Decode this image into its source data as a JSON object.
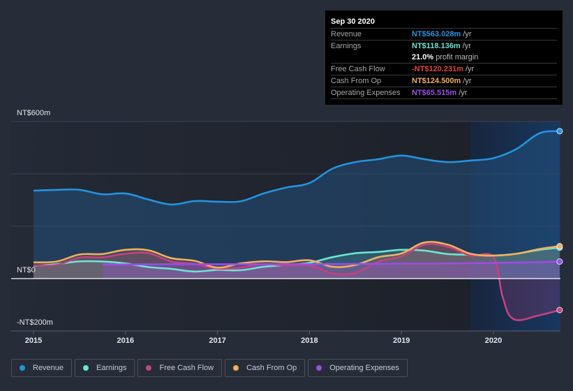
{
  "tooltip": {
    "date": "Sep 30 2020",
    "rows": [
      {
        "label": "Revenue",
        "value": "NT$563.028m",
        "unit": "/yr",
        "color": "#2394df"
      },
      {
        "label": "Earnings",
        "value": "NT$118.136m",
        "unit": "/yr",
        "color": "#6ce5d1"
      },
      {
        "label": "",
        "value": "21.0%",
        "unit": "profit margin",
        "color": "#ffffff"
      },
      {
        "label": "Free Cash Flow",
        "value": "-NT$120.231m",
        "unit": "/yr",
        "color": "#e64141"
      },
      {
        "label": "Cash From Op",
        "value": "NT$124.500m",
        "unit": "/yr",
        "color": "#f0b05c"
      },
      {
        "label": "Operating Expenses",
        "value": "NT$65.515m",
        "unit": "/yr",
        "color": "#9d4ce8"
      }
    ]
  },
  "legend": [
    {
      "label": "Revenue",
      "color": "#2394df"
    },
    {
      "label": "Earnings",
      "color": "#6ce5d1"
    },
    {
      "label": "Free Cash Flow",
      "color": "#c4427f"
    },
    {
      "label": "Cash From Op",
      "color": "#f0b05c"
    },
    {
      "label": "Operating Expenses",
      "color": "#9d4ce8"
    }
  ],
  "chart_data": {
    "type": "area",
    "title": "",
    "xlabel": "",
    "ylabel": "",
    "currency": "NT$",
    "ylim": [
      -200,
      600
    ],
    "xlim": [
      2014.9,
      2020.76
    ],
    "y_ticks": [
      {
        "value": 600,
        "label": "NT$600m"
      },
      {
        "value": 0,
        "label": "NT$0"
      },
      {
        "value": -200,
        "label": "-NT$200m"
      }
    ],
    "gridlines": [
      600,
      400,
      200,
      0,
      -200
    ],
    "x_ticks": [
      {
        "value": 2015,
        "label": "2015"
      },
      {
        "value": 2016,
        "label": "2016"
      },
      {
        "value": 2017,
        "label": "2017"
      },
      {
        "value": 2018,
        "label": "2018"
      },
      {
        "value": 2019,
        "label": "2019"
      },
      {
        "value": 2020,
        "label": "2020"
      }
    ],
    "forecast_shade_start": 2019.75,
    "legend_position": "bottom",
    "series": [
      {
        "name": "Revenue",
        "color": "#2394df",
        "x": [
          2015.0,
          2015.25,
          2015.5,
          2015.75,
          2016.0,
          2016.25,
          2016.5,
          2016.75,
          2017.0,
          2017.25,
          2017.5,
          2017.75,
          2018.0,
          2018.25,
          2018.5,
          2018.75,
          2019.0,
          2019.25,
          2019.5,
          2019.75,
          2020.0,
          2020.25,
          2020.5,
          2020.72
        ],
        "values": [
          336,
          339,
          339,
          322,
          325,
          302,
          283,
          296,
          294,
          295,
          325,
          348,
          365,
          420,
          445,
          456,
          470,
          456,
          445,
          451,
          460,
          495,
          555,
          563
        ]
      },
      {
        "name": "Earnings",
        "color": "#6ce5d1",
        "x": [
          2015.0,
          2015.25,
          2015.5,
          2015.75,
          2016.0,
          2016.25,
          2016.5,
          2016.75,
          2017.0,
          2017.25,
          2017.5,
          2017.75,
          2018.0,
          2018.25,
          2018.5,
          2018.75,
          2019.0,
          2019.25,
          2019.5,
          2019.75,
          2020.0,
          2020.25,
          2020.5,
          2020.72
        ],
        "values": [
          48,
          55,
          66,
          65,
          58,
          44,
          37,
          27,
          33,
          32,
          45,
          52,
          60,
          82,
          97,
          102,
          110,
          107,
          94,
          91,
          88,
          95,
          110,
          118
        ]
      },
      {
        "name": "Free Cash Flow",
        "color": "#c4427f",
        "x": [
          2015.0,
          2015.25,
          2015.5,
          2015.75,
          2016.0,
          2016.25,
          2016.5,
          2016.75,
          2017.0,
          2017.25,
          2017.5,
          2017.75,
          2018.0,
          2018.25,
          2018.5,
          2018.75,
          2019.0,
          2019.25,
          2019.5,
          2019.75,
          2020.0,
          2020.1,
          2020.22,
          2020.5,
          2020.72
        ],
        "values": [
          50,
          52,
          80,
          81,
          95,
          97,
          65,
          56,
          38,
          42,
          55,
          50,
          50,
          20,
          22,
          65,
          85,
          130,
          122,
          88,
          82,
          -70,
          -155,
          -140,
          -120
        ]
      },
      {
        "name": "Cash From Op",
        "color": "#f0b05c",
        "x": [
          2015.0,
          2015.25,
          2015.5,
          2015.75,
          2016.0,
          2016.25,
          2016.5,
          2016.75,
          2017.0,
          2017.25,
          2017.5,
          2017.75,
          2018.0,
          2018.25,
          2018.5,
          2018.75,
          2019.0,
          2019.25,
          2019.5,
          2019.75,
          2020.0,
          2020.25,
          2020.5,
          2020.72
        ],
        "values": [
          62,
          65,
          92,
          94,
          110,
          108,
          78,
          68,
          42,
          58,
          66,
          63,
          70,
          45,
          52,
          82,
          96,
          138,
          130,
          95,
          88,
          95,
          113,
          124
        ]
      },
      {
        "name": "Operating Expenses",
        "color": "#9d4ce8",
        "x": [
          2015.75,
          2016.0,
          2016.5,
          2017.0,
          2017.5,
          2018.0,
          2018.5,
          2019.0,
          2019.5,
          2020.0,
          2020.5,
          2020.72
        ],
        "values": [
          54,
          54,
          55,
          55,
          55,
          55,
          56,
          57,
          58,
          60,
          63,
          65
        ]
      }
    ]
  }
}
